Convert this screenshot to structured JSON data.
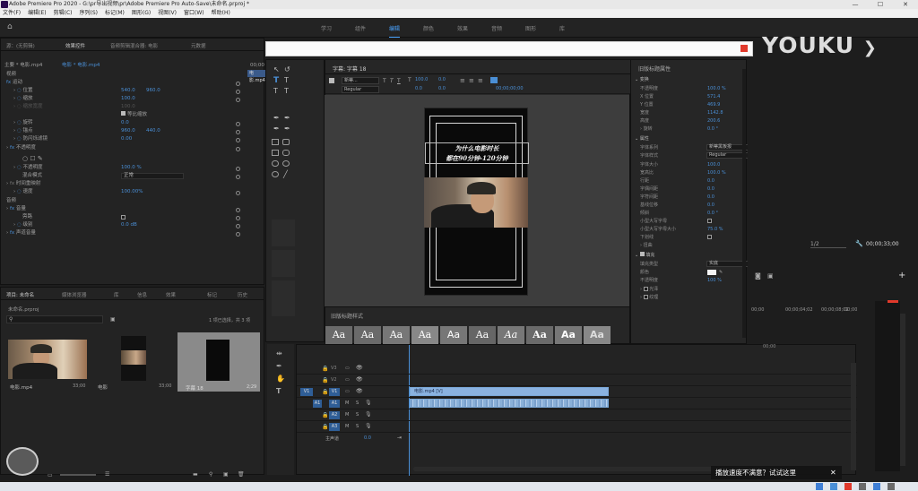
{
  "titlebar": {
    "title": "Adobe Premiere Pro 2020 - G:\\pr导出视频\\pr\\Adobe Premiere Pro Auto-Save\\未命名.prproj *",
    "min": "—",
    "max": "☐",
    "close": "✕"
  },
  "menu": [
    "文件(F)",
    "编辑(E)",
    "剪辑(C)",
    "序列(S)",
    "标记(M)",
    "图形(G)",
    "视图(V)",
    "窗口(W)",
    "帮助(H)"
  ],
  "workspaces": [
    "学习",
    "组件",
    "编辑",
    "颜色",
    "效果",
    "音频",
    "图形",
    "库"
  ],
  "effect_controls": {
    "tabs": [
      "源：(无剪辑)",
      "效果控件",
      "音频剪辑混合器: 电影",
      "元数据"
    ],
    "source": "主要 * 电影.mp4",
    "sequence": "电影 * 电影.mp4",
    "timecode": "00;00",
    "clip_label": "电影.mp4",
    "video_section": "视频",
    "motion": "运动",
    "rows": [
      {
        "label": "位置",
        "v1": "540.0",
        "v2": "960.0"
      },
      {
        "label": "缩放",
        "v1": "100.0",
        "v2": ""
      },
      {
        "label": "缩放宽度",
        "v1": "100.0",
        "v2": ""
      },
      {
        "label": "等比缩放",
        "v1": "",
        "v2": ""
      },
      {
        "label": "旋转",
        "v1": "0.0",
        "v2": ""
      },
      {
        "label": "锚点",
        "v1": "960.0",
        "v2": "440.0"
      },
      {
        "label": "防闪烁滤镜",
        "v1": "0.00",
        "v2": ""
      }
    ],
    "opacity": "不透明度",
    "opacity_value": "100.0 %",
    "blend": "混合模式",
    "blend_value": "正常",
    "time_remap": "时间重映射",
    "speed": "速度",
    "speed_value": "100.00%",
    "audio_section": "音频",
    "volume": "音量",
    "bypass": "旁路",
    "level": "级别",
    "level_value": "0.0 dB",
    "channel": "声道音量"
  },
  "titler": {
    "header": "字幕: 字幕 18",
    "font": "新蒂...",
    "font_style": "Regular",
    "size": "100.0",
    "kern": "0.0",
    "lead": "0.0",
    "timecode": "00;00;00;00"
  },
  "caption": {
    "line1": "为什么电影时长",
    "line2": "都在90分钟-120分钟"
  },
  "styles_title": "旧版标题样式",
  "style_samples": [
    "Aa",
    "Aa",
    "Aa",
    "Aa",
    "Aa",
    "Aa",
    "Aa",
    "Aa",
    "Aa",
    "Aa"
  ],
  "props": {
    "title": "旧版标题属性",
    "transform": "变换",
    "rows": [
      {
        "label": "不透明度",
        "value": "100.0 %"
      },
      {
        "label": "X 位置",
        "value": "571.4"
      },
      {
        "label": "Y 位置",
        "value": "469.9"
      },
      {
        "label": "宽度",
        "value": "1142.8"
      },
      {
        "label": "高度",
        "value": "200.6"
      },
      {
        "label": "旋转",
        "value": "0.0 °"
      }
    ],
    "attributes": "属性",
    "font_family_label": "字体系列",
    "font_family": "新蒂黑板报",
    "font_style_label": "字体样式",
    "font_style": "Regular",
    "rows2": [
      {
        "label": "字体大小",
        "value": "100.0"
      },
      {
        "label": "宽高比",
        "value": "100.0 %"
      },
      {
        "label": "行距",
        "value": "0.0"
      },
      {
        "label": "字偶间距",
        "value": "0.0"
      },
      {
        "label": "字符间距",
        "value": "0.0"
      },
      {
        "label": "基线位移",
        "value": "0.0"
      },
      {
        "label": "倾斜",
        "value": "0.0 °"
      }
    ],
    "smallcaps": "小型大写字母",
    "smallcaps_size": "小型大写字母大小",
    "smallcaps_value": "75.0 %",
    "underline": "下划线",
    "distort": "扭曲",
    "fill": "填充",
    "fill_type_label": "填充类型",
    "fill_type": "实底",
    "color": "颜色",
    "opacity": "不透明度",
    "opacity_value": "100 %",
    "sheen": "光泽",
    "texture": "纹理"
  },
  "program": {
    "zoom": "1/2",
    "timecode": "00;00;33;00"
  },
  "ruler": [
    "00;00",
    "00;00;04;02",
    "00;00;08;02",
    "00;00;12"
  ],
  "tracks": {
    "video": [
      {
        "id": "V3"
      },
      {
        "id": "V2"
      },
      {
        "id": "V1"
      }
    ],
    "audio": [
      {
        "id": "A1"
      },
      {
        "id": "A2"
      },
      {
        "id": "A3"
      }
    ],
    "master": "主声道",
    "master_value": "0.0",
    "mute": "M",
    "solo": "S",
    "clip_v1": "电影.mp4 [V]"
  },
  "project": {
    "tabs": [
      "项目: 未命名",
      "媒体浏览器",
      "库",
      "信息",
      "效果",
      "标记",
      "历史"
    ],
    "path": "未命名.prproj",
    "selection": "1 项已选择，共 3 项",
    "items": [
      {
        "name": "电影.mp4",
        "duration": "33;00"
      },
      {
        "name": "电影",
        "duration": "33;00"
      },
      {
        "name": "字幕 18",
        "duration": "2;29"
      }
    ]
  },
  "youku": "YOUKU",
  "tip": {
    "text": "播放速度不满意？试试这里",
    "close": "✕"
  }
}
